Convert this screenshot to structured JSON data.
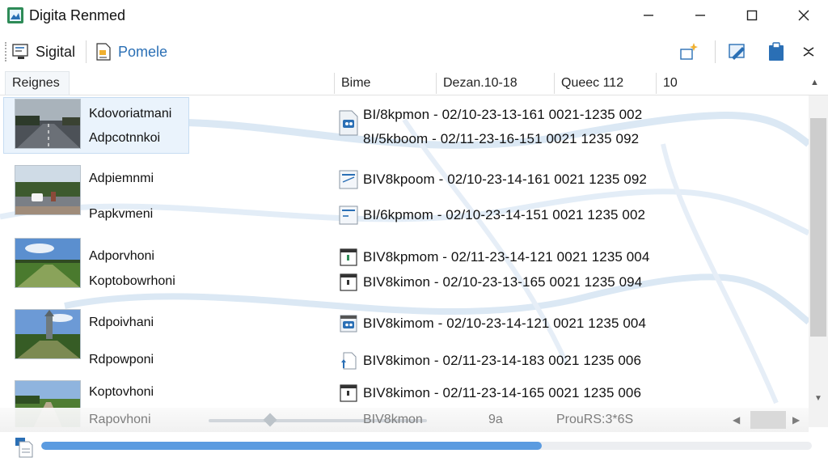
{
  "window": {
    "title": "Digita Renmed",
    "icon": "app-image-icon"
  },
  "toolbar": {
    "btn1_label": "Sigital",
    "btn2_label": "Pomele",
    "btn2_color": "#2a6fb5"
  },
  "columns": [
    "Reignes",
    "Bime",
    "Dezan.10-18",
    "Queec 112",
    "10"
  ],
  "groups": [
    {
      "thumb": "road-highway",
      "selected": true,
      "rows": [
        {
          "name": "Kdovoriatmani",
          "icon": "image-file-icon",
          "info": "BI/8kpmon - 02/10-23-13-161 0021-1235 002"
        },
        {
          "name": "Adpcotnnkoi",
          "icon": "",
          "info": "8I/5kboom - 02/11-23-16-151 0021 1235 092"
        }
      ]
    },
    {
      "thumb": "road-car",
      "selected": false,
      "rows": [
        {
          "name": "Adpiemnmi",
          "icon": "doc-file-icon",
          "info": "BIV8kpoom - 02/10-23-14-161 0021 1235 092"
        },
        {
          "name": "Papkvmeni",
          "icon": "doc-file-icon",
          "info": "BI/6kpmom - 02/10-23-14-151 0021 1235 002"
        }
      ]
    },
    {
      "thumb": "field-sky",
      "selected": false,
      "rows": [
        {
          "name": "Adporvhoni",
          "icon": "green-file-icon",
          "info": "BIV8kpmom - 02/11-23-14-121 0021 1235 004"
        },
        {
          "name": "Koptobowrhoni",
          "icon": "black-file-icon",
          "info": "BIV8kimon - 02/10-23-13-165 0021 1235 094"
        }
      ]
    },
    {
      "thumb": "castle-trees",
      "selected": false,
      "rows": [
        {
          "name": "Rdpoivhani",
          "icon": "image-file-icon",
          "info": "BIV8kimom - 02/10-23-14-121 0021 1235 004"
        },
        {
          "name": "Rdpowponi",
          "icon": "upload-file-icon",
          "info": "BIV8kimon - 02/11-23-14-183 0021 1235 006"
        }
      ]
    },
    {
      "thumb": "path-field",
      "selected": false,
      "rows": [
        {
          "name": "Koptovhoni",
          "icon": "black-file-icon",
          "info": "BIV8kimon - 02/11-23-14-165 0021 1235 006"
        }
      ]
    }
  ],
  "partial_row": {
    "name": "Rapovhoni",
    "info": "BIV8kmon",
    "extra": "9a",
    "prop": "ProuRS:3*6S"
  },
  "status": {
    "progress": 0.65,
    "progress_color": "#5b9be0"
  }
}
